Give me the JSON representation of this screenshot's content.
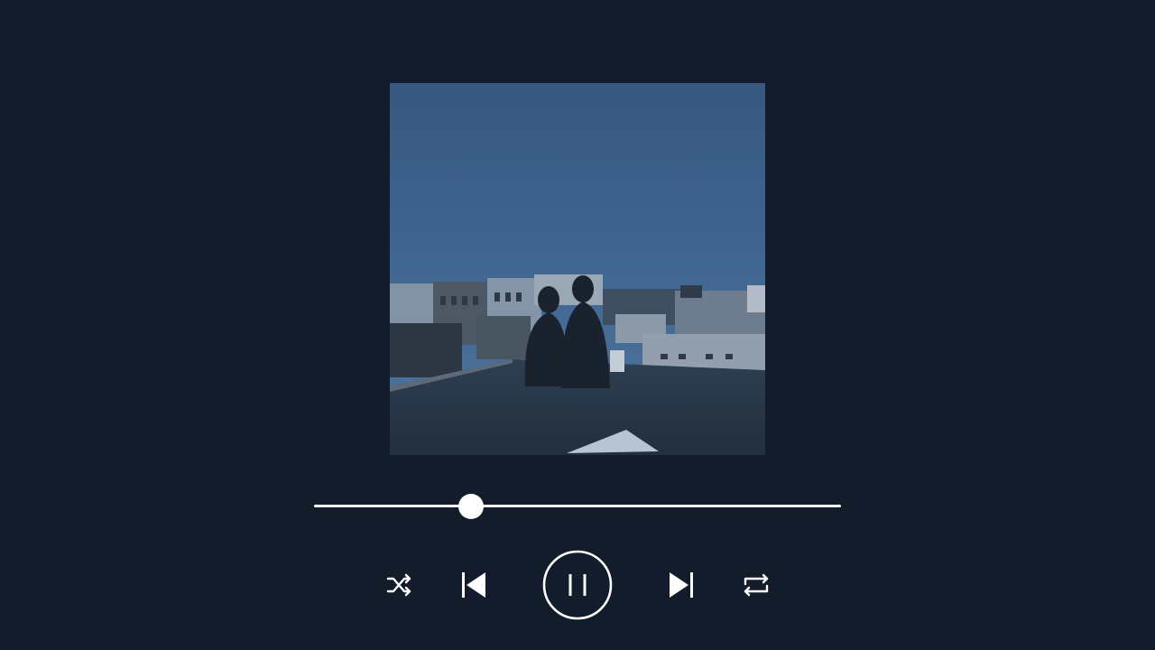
{
  "player": {
    "progress": {
      "fraction": 0.298
    },
    "controls": {
      "shuffle": {
        "icon": "shuffle-icon"
      },
      "previous": {
        "icon": "skip-previous-icon"
      },
      "play_pause": {
        "icon": "pause-icon",
        "state": "playing"
      },
      "next": {
        "icon": "skip-next-icon"
      },
      "repeat": {
        "icon": "repeat-icon"
      }
    },
    "colors": {
      "background": "#121c2b",
      "foreground": "#ffffff"
    }
  }
}
